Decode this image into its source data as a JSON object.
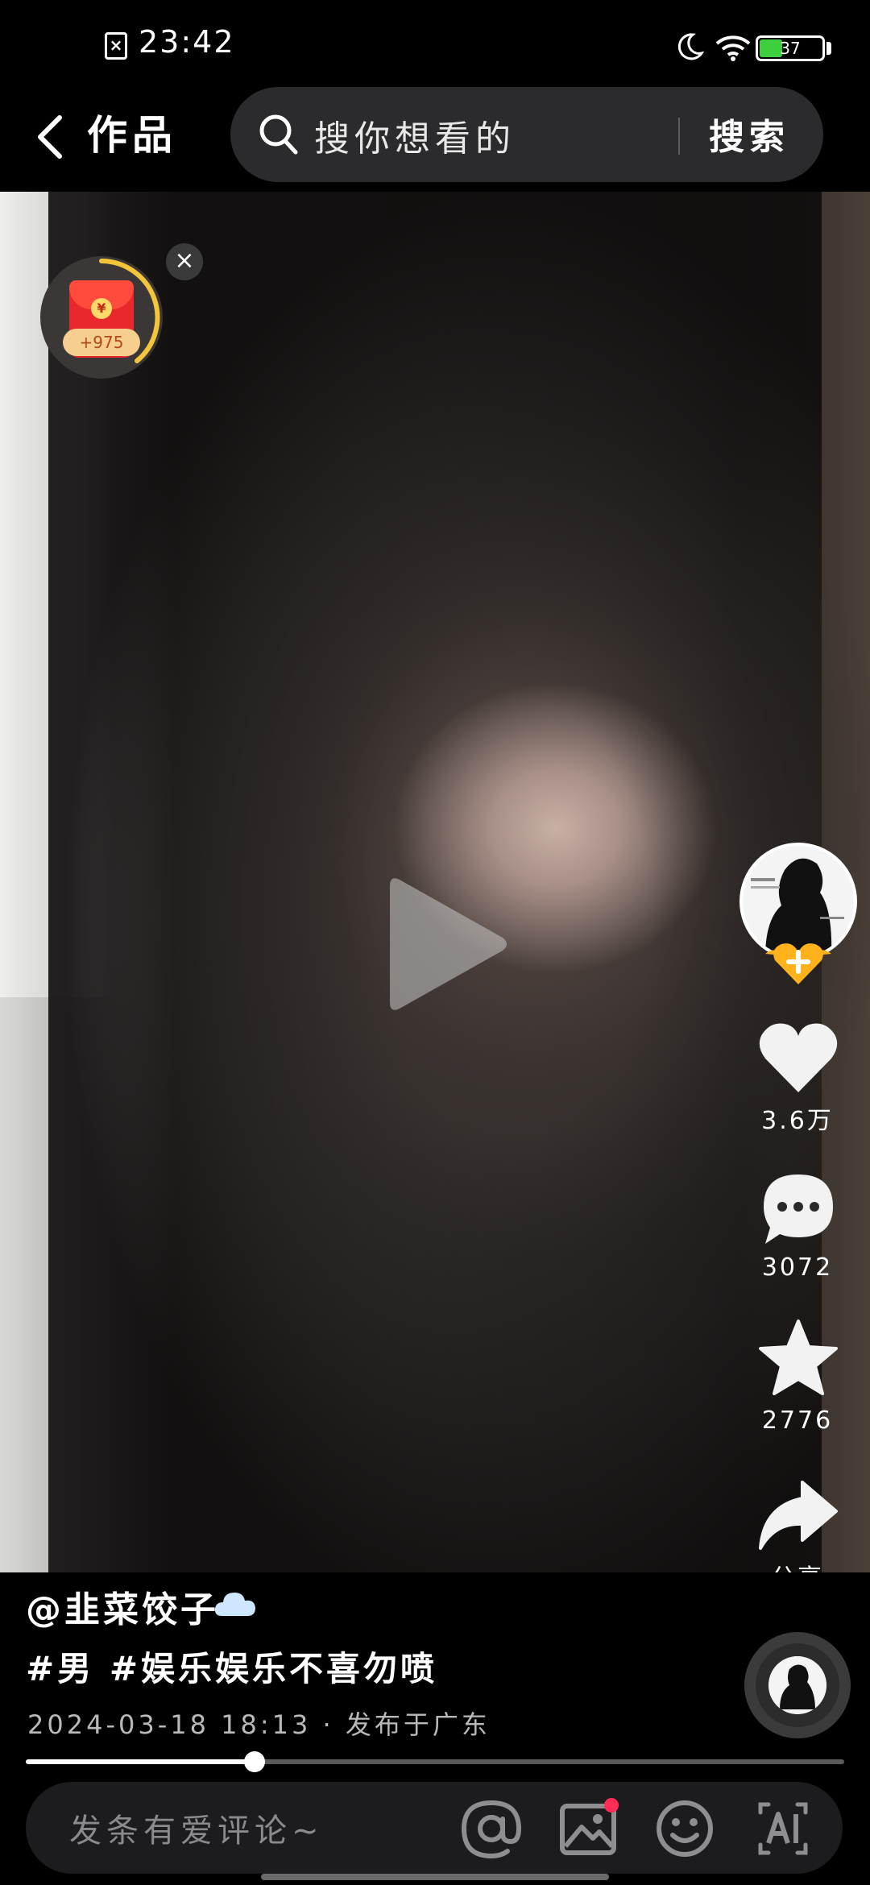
{
  "status_bar": {
    "time": "23:42",
    "battery_level": "37",
    "battery_fraction": 0.37,
    "icons": [
      "no-sim-icon",
      "moon-icon",
      "wifi-icon",
      "battery-icon"
    ]
  },
  "header": {
    "title": "作品",
    "search_placeholder": "搜你想看的",
    "search_button": "搜索"
  },
  "red_packet": {
    "reward": "+975",
    "coin_symbol": "¥"
  },
  "right_rail": {
    "likes": "3.6万",
    "comments": "3072",
    "favorites": "2776",
    "share": "分享"
  },
  "post": {
    "author": "@韭菜饺子",
    "tags": "#男 #娱乐娱乐不喜勿喷",
    "published": "2024-03-18 18:13 · 发布于广东",
    "progress": 0.28
  },
  "comment_bar": {
    "placeholder": "发条有爱评论~"
  },
  "colors": {
    "battery_green": "#3ecf3e",
    "red_packet": "#e8282c",
    "ring_gold": "#f4c53b",
    "notification_dot": "#ff2c55",
    "follow_orange": "#ffb21c"
  }
}
